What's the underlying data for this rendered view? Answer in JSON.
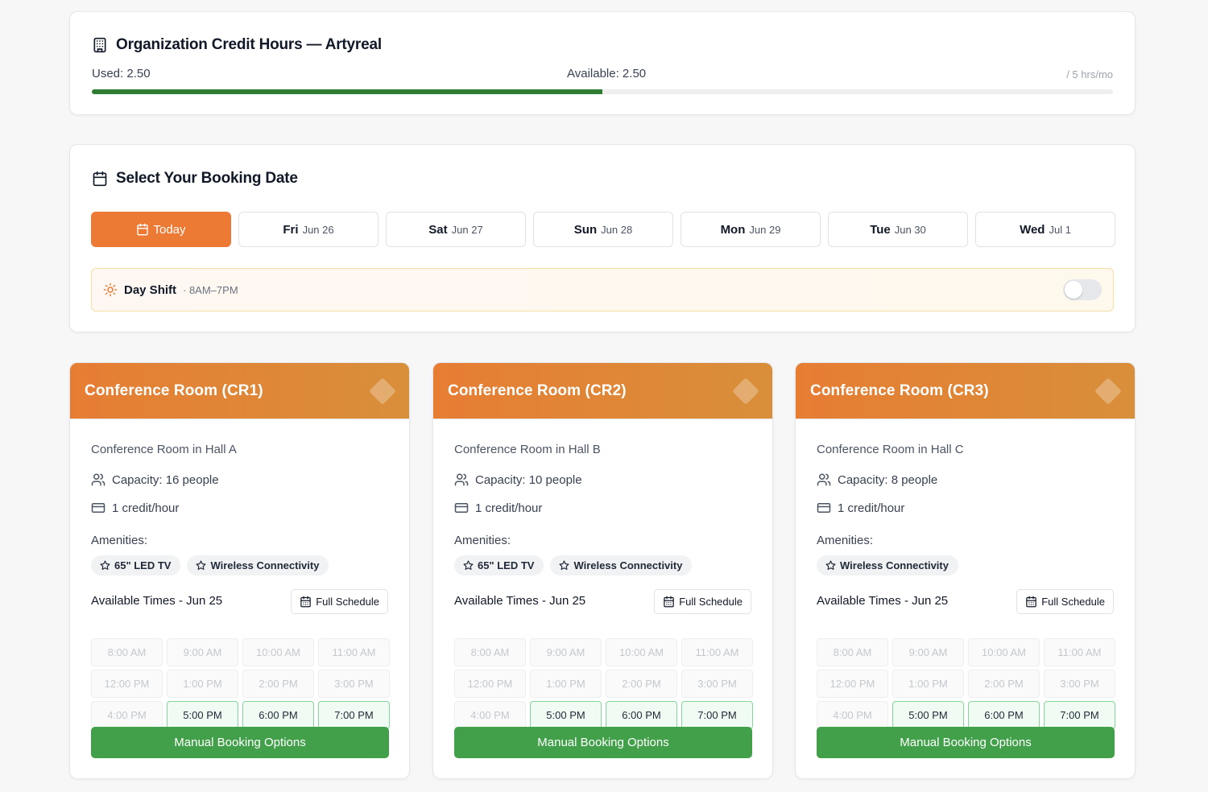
{
  "credit": {
    "title": "Organization Credit Hours — Artyreal",
    "used": "Used: 2.50",
    "available": "Available: 2.50",
    "limit": "/ 5 hrs/mo",
    "progress_fraction": 0.5,
    "bar_color": "#2f7d32"
  },
  "booking": {
    "title": "Select Your Booking Date",
    "today_label": "Today",
    "days": [
      {
        "dow": "Fri",
        "date": "Jun 26"
      },
      {
        "dow": "Sat",
        "date": "Jun 27"
      },
      {
        "dow": "Sun",
        "date": "Jun 28"
      },
      {
        "dow": "Mon",
        "date": "Jun 29"
      },
      {
        "dow": "Tue",
        "date": "Jun 30"
      },
      {
        "dow": "Wed",
        "date": "Jul 1"
      }
    ],
    "shift": {
      "name": "Day Shift",
      "hours": "· 8AM–7PM",
      "toggle_on": false
    },
    "accent": "#ec7a34"
  },
  "rooms": [
    {
      "title": "Conference Room (CR1)",
      "description": "Conference Room in Hall A",
      "capacity": "Capacity: 16 people",
      "rate": "1 credit/hour",
      "amenities_label": "Amenities:",
      "amenities": [
        "65\" LED TV",
        "Wireless Connectivity"
      ],
      "available_title": "Available Times - Jun 25",
      "full_schedule": "Full Schedule",
      "manual_button": "Manual Booking Options"
    },
    {
      "title": "Conference Room (CR2)",
      "description": "Conference Room in Hall B",
      "capacity": "Capacity: 10 people",
      "rate": "1 credit/hour",
      "amenities_label": "Amenities:",
      "amenities": [
        "65\" LED TV",
        "Wireless Connectivity"
      ],
      "available_title": "Available Times - Jun 25",
      "full_schedule": "Full Schedule",
      "manual_button": "Manual Booking Options"
    },
    {
      "title": "Conference Room (CR3)",
      "description": "Conference Room in Hall C",
      "capacity": "Capacity: 8 people",
      "rate": "1 credit/hour",
      "amenities_label": "Amenities:",
      "amenities": [
        "Wireless Connectivity"
      ],
      "available_title": "Available Times - Jun 25",
      "full_schedule": "Full Schedule",
      "manual_button": "Manual Booking Options"
    }
  ],
  "time_slots": [
    {
      "label": "8:00 AM",
      "available": false
    },
    {
      "label": "9:00 AM",
      "available": false
    },
    {
      "label": "10:00 AM",
      "available": false
    },
    {
      "label": "11:00 AM",
      "available": false
    },
    {
      "label": "12:00 PM",
      "available": false
    },
    {
      "label": "1:00 PM",
      "available": false
    },
    {
      "label": "2:00 PM",
      "available": false
    },
    {
      "label": "3:00 PM",
      "available": false
    },
    {
      "label": "4:00 PM",
      "available": false
    },
    {
      "label": "5:00 PM",
      "available": true
    },
    {
      "label": "6:00 PM",
      "available": true
    },
    {
      "label": "7:00 PM",
      "available": true
    }
  ],
  "colors": {
    "room_header": "#e67d33",
    "manual_button": "#43a04a",
    "available_slot_border": "#86d59a"
  },
  "icons": {
    "credit_title": "building-icon",
    "booking_title": "calendar-icon",
    "shift": "sun-icon",
    "capacity": "users-icon",
    "rate": "credit-card-icon",
    "amenity": "star-icon",
    "schedule": "calendar-icon"
  }
}
